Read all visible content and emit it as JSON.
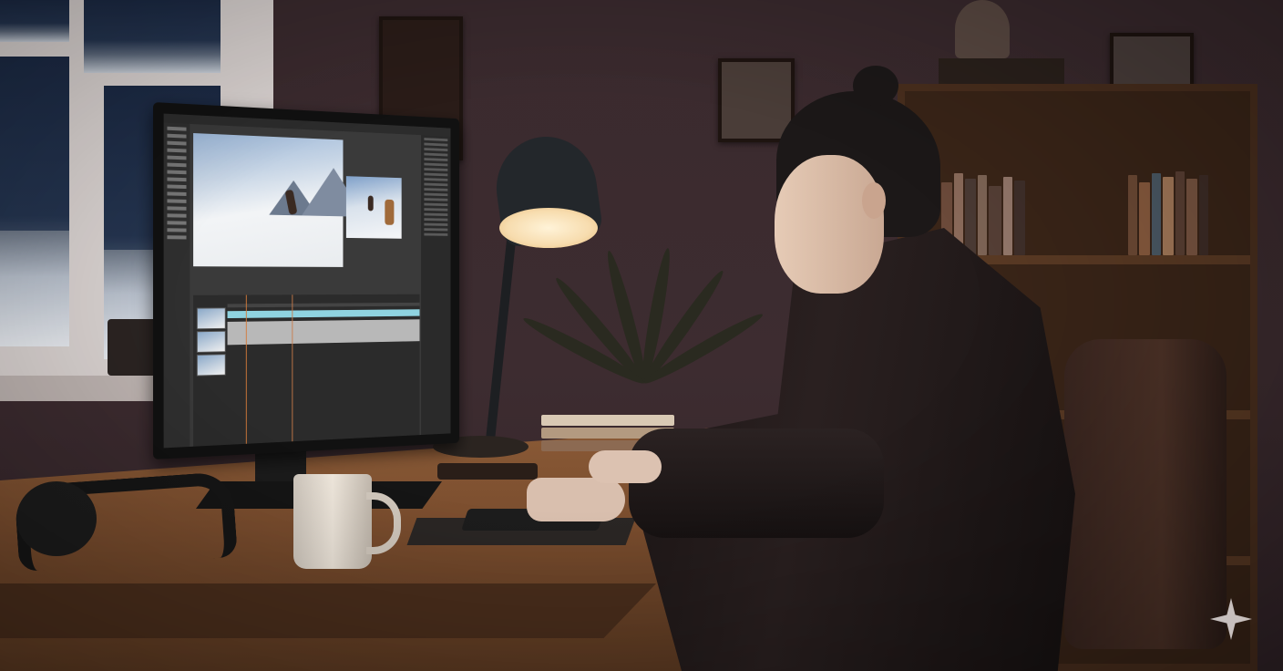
{
  "scene": {
    "description_kind": "illustration",
    "palette": {
      "wall": "#3d2c30",
      "desk_wood": "#7a4d2e",
      "lamp_light": "#f7dcae",
      "screen_ui": "#3a3a3a",
      "snow": "#e6e9ee",
      "sky_night": "#1c2a44",
      "accent_timeline": "#8fd3e0"
    }
  },
  "monitor": {
    "app_panels": [
      "menubar",
      "tools",
      "preview",
      "secondary-preview",
      "properties-panel",
      "timeline"
    ]
  },
  "icons": {
    "corner_mark": "sparkle-icon"
  }
}
